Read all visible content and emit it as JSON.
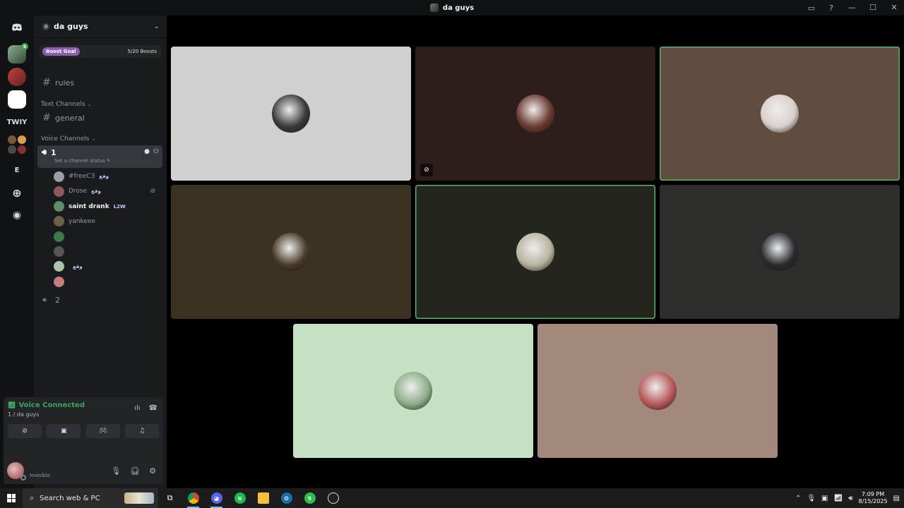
{
  "window": {
    "title": "da guys"
  },
  "rail": {
    "twiy_label": "TWIY",
    "e_label": "E",
    "badge_count": "6"
  },
  "guild": {
    "name": "da guys",
    "boost_label": "Boost Goal",
    "boost_count": "5/20 Boosts"
  },
  "channels": {
    "rules": "rules",
    "text_category": "Text Channels",
    "general": "general",
    "voice_category": "Voice Channels",
    "voice_1": "1",
    "voice_1_status": "Set a channel status",
    "voice_2": "2"
  },
  "members": [
    {
      "name": "#freeC3",
      "tag": "وقع",
      "bright": false,
      "avatar": "#9aa0a6"
    },
    {
      "name": "Drose",
      "tag": "وقع",
      "bright": false,
      "avatar": "#8a5a5a",
      "muted": true
    },
    {
      "name": "saint drank",
      "tag": "L2W",
      "bright": true,
      "avatar": "#5f8f6a"
    },
    {
      "name": "yankeee",
      "tag": "",
      "bright": false,
      "avatar": "#6b6048"
    },
    {
      "name": "",
      "tag": "",
      "bright": false,
      "avatar": "#3d7a4a"
    },
    {
      "name": "",
      "tag": "",
      "bright": false,
      "avatar": "#555"
    },
    {
      "name": "",
      "tag": "وقع",
      "bright": false,
      "avatar": "#a8c8a8"
    },
    {
      "name": "",
      "tag": "",
      "bright": false,
      "avatar": "#c47c7c"
    }
  ],
  "voice_panel": {
    "status": "Voice Connected",
    "location": "1 / da guys"
  },
  "user": {
    "status": "Invisible"
  },
  "tiles": [
    {
      "bg": "#d0d0d0",
      "face": "#3a3a3a",
      "speaking": false,
      "muted": false
    },
    {
      "bg": "#2d1d1b",
      "face": "#6b3a30",
      "speaking": false,
      "muted": true
    },
    {
      "bg": "#614d3f",
      "face": "#d9d0cc",
      "speaking": true,
      "muted": false
    },
    {
      "bg": "#3a3223",
      "face": "#4a3c2a",
      "speaking": false,
      "muted": false
    },
    {
      "bg": "#24251f",
      "face": "#b8b4a0",
      "speaking": true,
      "muted": false
    },
    {
      "bg": "#2d2e2c",
      "face": "#2a2c30",
      "speaking": false,
      "muted": false
    },
    {
      "bg": "#c6e0c5",
      "face": "#8fae88",
      "speaking": false,
      "muted": false
    },
    {
      "bg": "#a3887c",
      "face": "#b85a5a",
      "speaking": false,
      "muted": false
    }
  ],
  "taskbar": {
    "search_placeholder": "Search web & PC",
    "time": "7:09 PM",
    "date": "8/15/2025"
  }
}
